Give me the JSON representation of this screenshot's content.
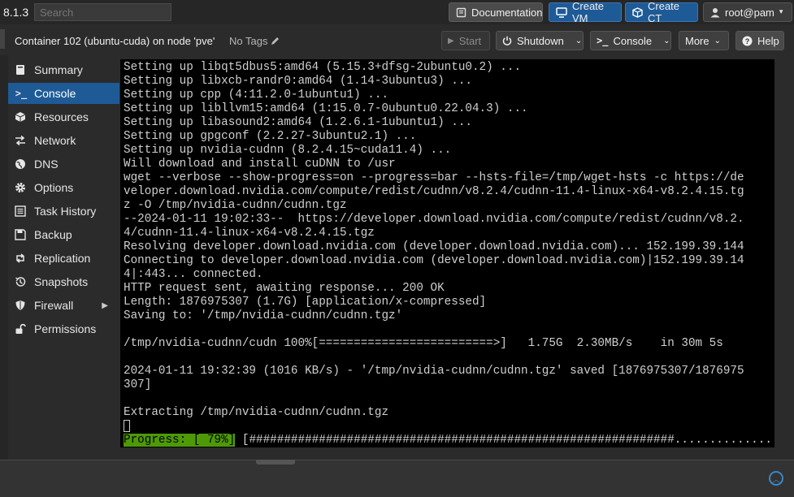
{
  "header": {
    "version": "8.1.3",
    "search_placeholder": "Search",
    "documentation_label": "Documentation",
    "create_vm_label": "Create VM",
    "create_ct_label": "Create CT",
    "user_label": "root@pam"
  },
  "container": {
    "title": "Container 102 (ubuntu-cuda) on node 'pve'",
    "tags_label": "No Tags",
    "start_label": "Start",
    "shutdown_label": "Shutdown",
    "console_label": "Console",
    "more_label": "More",
    "help_label": "Help"
  },
  "sidebar": {
    "items": [
      {
        "label": "Summary",
        "icon": "book-icon"
      },
      {
        "label": "Console",
        "icon": "terminal-icon"
      },
      {
        "label": "Resources",
        "icon": "cube-icon"
      },
      {
        "label": "Network",
        "icon": "exchange-icon"
      },
      {
        "label": "DNS",
        "icon": "globe-icon"
      },
      {
        "label": "Options",
        "icon": "gear-icon"
      },
      {
        "label": "Task History",
        "icon": "list-icon"
      },
      {
        "label": "Backup",
        "icon": "floppy-icon"
      },
      {
        "label": "Replication",
        "icon": "retweet-icon"
      },
      {
        "label": "Snapshots",
        "icon": "history-icon"
      },
      {
        "label": "Firewall",
        "icon": "shield-icon"
      },
      {
        "label": "Permissions",
        "icon": "unlock-icon"
      }
    ],
    "active_index": 1
  },
  "console": {
    "lines": [
      "Setting up libqt5dbus5:amd64 (5.15.3+dfsg-2ubuntu0.2) ...",
      "Setting up libxcb-randr0:amd64 (1.14-3ubuntu3) ...",
      "Setting up cpp (4:11.2.0-1ubuntu1) ...",
      "Setting up libllvm15:amd64 (1:15.0.7-0ubuntu0.22.04.3) ...",
      "Setting up libasound2:amd64 (1.2.6.1-1ubuntu1) ...",
      "Setting up gpgconf (2.2.27-3ubuntu2.1) ...",
      "Setting up nvidia-cudnn (8.2.4.15~cuda11.4) ...",
      "Will download and install cuDNN to /usr",
      "wget --verbose --show-progress=on --progress=bar --hsts-file=/tmp/wget-hsts -c https://de",
      "veloper.download.nvidia.com/compute/redist/cudnn/v8.2.4/cudnn-11.4-linux-x64-v8.2.4.15.tg",
      "z -O /tmp/nvidia-cudnn/cudnn.tgz",
      "--2024-01-11 19:02:33--  https://developer.download.nvidia.com/compute/redist/cudnn/v8.2.",
      "4/cudnn-11.4-linux-x64-v8.2.4.15.tgz",
      "Resolving developer.download.nvidia.com (developer.download.nvidia.com)... 152.199.39.144",
      "Connecting to developer.download.nvidia.com (developer.download.nvidia.com)|152.199.39.14",
      "4|:443... connected.",
      "HTTP request sent, awaiting response... 200 OK",
      "Length: 1876975307 (1.7G) [application/x-compressed]",
      "Saving to: '/tmp/nvidia-cudnn/cudnn.tgz'",
      "",
      "/tmp/nvidia-cudnn/cudn 100%[=========================>]   1.75G  2.30MB/s    in 30m 5s",
      "",
      "2024-01-11 19:32:39 (1016 KB/s) - '/tmp/nvidia-cudnn/cudnn.tgz' saved [1876975307/1876975",
      "307]",
      "",
      "Extracting /tmp/nvidia-cudnn/cudnn.tgz"
    ],
    "progress_label": "Progress: [ 79%]",
    "progress_bar": " [#############################################################...............]",
    "progress_value": 0.79
  }
}
